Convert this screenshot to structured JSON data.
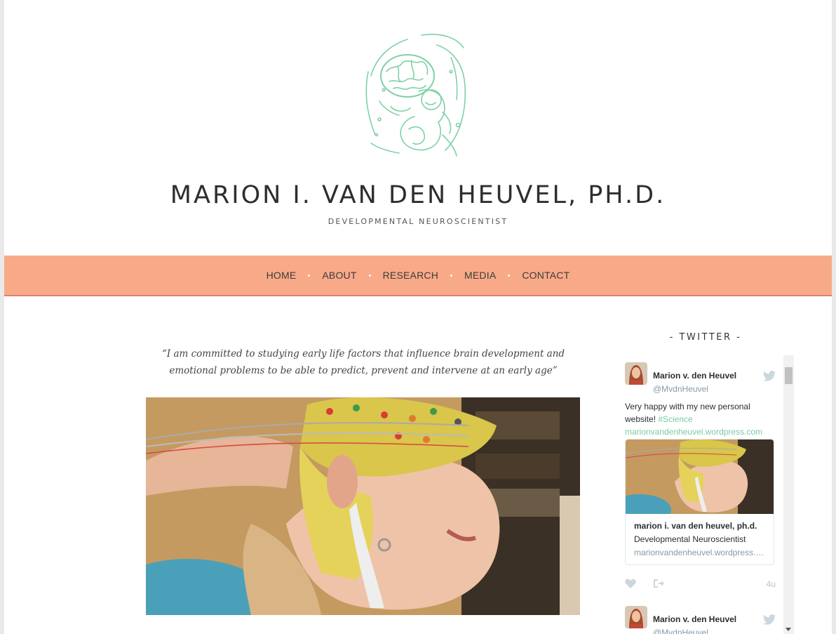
{
  "site": {
    "title": "MARION I. VAN DEN HEUVEL, PH.D.",
    "tagline": "DEVELOPMENTAL NEUROSCIENTIST",
    "accent_color": "#f8aa88",
    "logo_color": "#7fd1a6"
  },
  "nav": {
    "items": [
      {
        "label": "HOME"
      },
      {
        "label": "ABOUT"
      },
      {
        "label": "RESEARCH"
      },
      {
        "label": "MEDIA"
      },
      {
        "label": "CONTACT"
      }
    ]
  },
  "main": {
    "quote": "“I am committed to studying early life factors that influence brain development and emotional problems to be able to predict, prevent and intervene at an early age”",
    "photo_icon": "child-eeg-cap-photo"
  },
  "sidebar": {
    "title": "- TWITTER -",
    "tweets": [
      {
        "author": "Marion v. den Heuvel",
        "handle": "@MvdnHeuvel",
        "text_before": "Very happy with my new personal website! ",
        "hashtag": "#Science",
        "link": "marionvandenheuvel.wordpress.com",
        "card": {
          "title": "marion i. van den heuvel, ph.d.",
          "description": "Developmental Neuroscientist",
          "url": "marionvandenheuvel.wordpress.com"
        },
        "time": "4u"
      },
      {
        "author": "Marion v. den Heuvel",
        "handle": "@MvdnHeuvel"
      }
    ]
  }
}
